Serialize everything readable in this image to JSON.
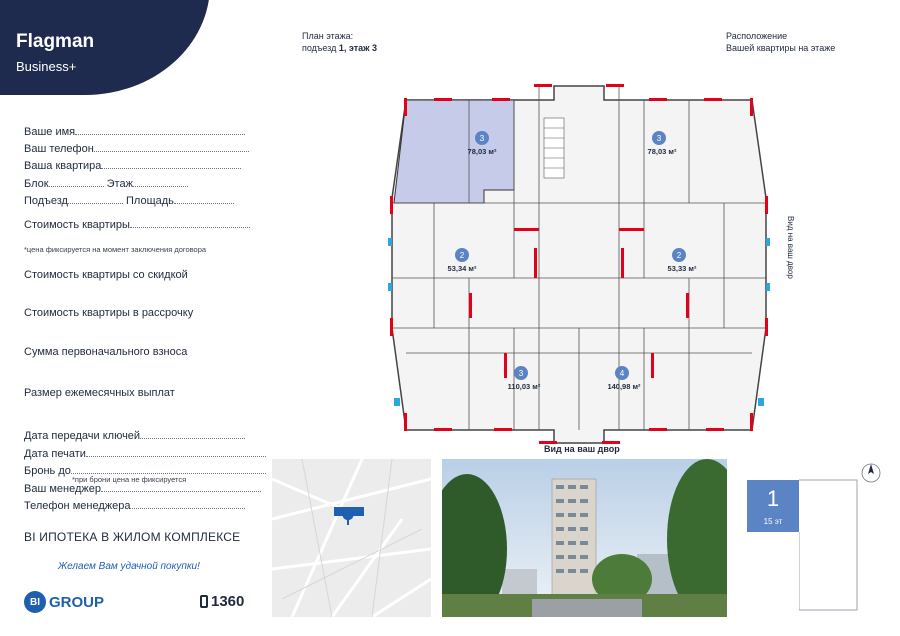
{
  "brand": {
    "title": "Flagman",
    "subtitle": "Business+"
  },
  "form": {
    "name": "Ваше имя",
    "phone": "Ваш телефон",
    "apartment": "Ваша квартира",
    "block": "Блок",
    "floor": "Этаж",
    "entrance": "Подъезд",
    "area": "Площадь",
    "price": "Стоимость квартиры",
    "price_note": "*цена фиксируется на момент заключения договора",
    "price_discount": "Стоимость квартиры со скидкой",
    "price_installment": "Стоимость квартиры в рассрочку",
    "down_payment": "Сумма первоначального взноса",
    "monthly_payment": "Размер ежемесячных выплат",
    "handover_date": "Дата передачи ключей",
    "print_date": "Дата печати",
    "booking": "Бронь до",
    "booking_note": "*при брони цена не фиксируется",
    "manager": "Ваш менеджер",
    "manager_phone": "Телефон менеджера"
  },
  "promo": "BI ИПОТЕКА В ЖИЛОМ КОМПЛЕКСЕ",
  "wish": "Желаем Вам удачной покупки!",
  "logo": {
    "mark": "BI",
    "text": "GROUP"
  },
  "phone": "1360",
  "plan_header": {
    "line1": "План этажа:",
    "line2_prefix": "подъезд ",
    "line2_value": "1, этаж 3"
  },
  "location_header": {
    "line1": "Расположение",
    "line2": "Вашей квартиры на этаже"
  },
  "view_side": "Вид на ваш двор",
  "view_bottom": "Вид на ваш двор",
  "apartments": [
    {
      "rooms": "3",
      "area": "78,03 м²"
    },
    {
      "rooms": "3",
      "area": "78,03 м²"
    },
    {
      "rooms": "2",
      "area": "53,34 м²"
    },
    {
      "rooms": "2",
      "area": "53,33 м²"
    },
    {
      "rooms": "3",
      "area": "110,03 м²"
    },
    {
      "rooms": "4",
      "area": "140,98 м²"
    }
  ],
  "floor_indicator": {
    "floor": "1",
    "total": "15 эт"
  },
  "colors": {
    "navy": "#1e2b4f",
    "accent": "#1e5fb0",
    "highlight": "#c5cbe8",
    "wall_red": "#e3001b"
  }
}
